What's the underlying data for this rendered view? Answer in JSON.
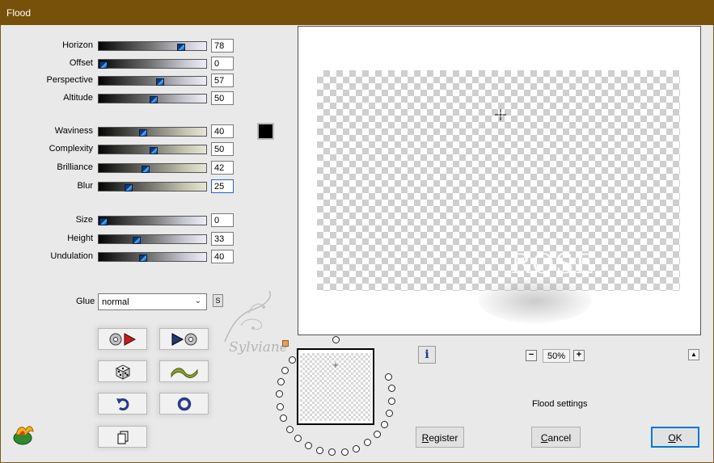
{
  "window": {
    "title": "Flood"
  },
  "sliders": [
    {
      "id": "horizon",
      "label": "Horizon",
      "value": "78",
      "level": 0.78,
      "color": "gray"
    },
    {
      "id": "offset",
      "label": "Offset",
      "value": "0",
      "level": 0.0,
      "color": "gray"
    },
    {
      "id": "perspective",
      "label": "Perspective",
      "value": "57",
      "level": 0.57,
      "color": "gray"
    },
    {
      "id": "altitude",
      "label": "Altitude",
      "value": "50",
      "level": 0.5,
      "color": "gray"
    },
    {
      "id": "waviness",
      "label": "Waviness",
      "value": "40",
      "level": 0.4,
      "color": "khaki"
    },
    {
      "id": "complexity",
      "label": "Complexity",
      "value": "50",
      "level": 0.5,
      "color": "khaki"
    },
    {
      "id": "brilliance",
      "label": "Brilliance",
      "value": "42",
      "level": 0.42,
      "color": "khaki"
    },
    {
      "id": "blur",
      "label": "Blur",
      "value": "25",
      "level": 0.25,
      "color": "khaki",
      "focused": true
    },
    {
      "id": "size",
      "label": "Size",
      "value": "0",
      "level": 0.0,
      "color": "gray"
    },
    {
      "id": "height",
      "label": "Height",
      "value": "33",
      "level": 0.33,
      "color": "gray"
    },
    {
      "id": "undulation",
      "label": "Undulation",
      "value": "40",
      "level": 0.4,
      "color": "gray"
    }
  ],
  "color_swatch": "#000000",
  "glue": {
    "label": "Glue",
    "selected": "normal",
    "s_button": "S"
  },
  "preview": {
    "watermark_text": "ROSE",
    "zoom": "50%"
  },
  "watermark_signature": "Sylviane",
  "status": {
    "flood_settings": "Flood settings"
  },
  "buttons": {
    "register": {
      "pre": "",
      "accel": "R",
      "post": "egister"
    },
    "cancel": {
      "pre": "",
      "accel": "C",
      "post": "ancel"
    },
    "ok": {
      "pre": "",
      "accel": "O",
      "post": "K"
    }
  },
  "icons": {
    "tool_1": "load-preset-icon",
    "tool_2": "save-preset-icon",
    "tool_3": "randomize-dice-icon",
    "tool_4": "wave-icon",
    "tool_5": "undo-icon",
    "tool_6": "reset-icon",
    "tool_7": "copy-icon"
  }
}
